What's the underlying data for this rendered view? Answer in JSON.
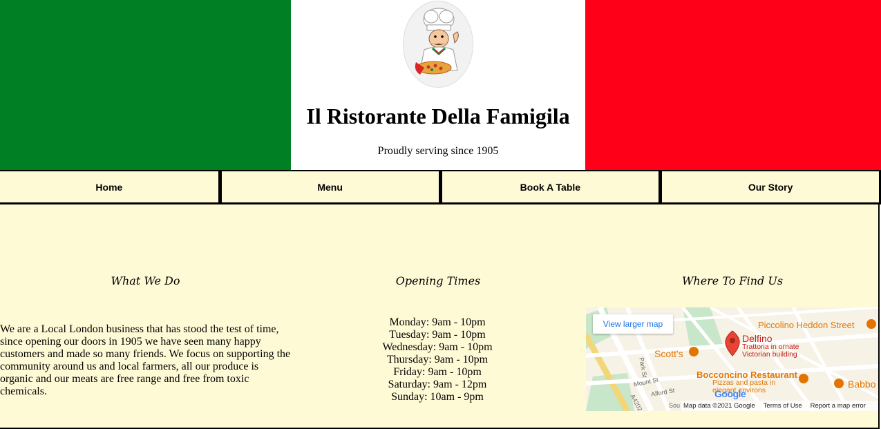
{
  "header": {
    "site_title": "Il Ristorante Della Famigila",
    "tagline": "Proudly serving since 1905",
    "colors": {
      "green": "#007f25",
      "white": "#ffffff",
      "red": "#ff0019"
    },
    "logo_icon": "chef-with-pizza-logo"
  },
  "nav": {
    "items": [
      {
        "label": "Home"
      },
      {
        "label": "Menu"
      },
      {
        "label": "Book A Table"
      },
      {
        "label": "Our Story"
      }
    ],
    "background": "#fffad6"
  },
  "what_we_do": {
    "heading": "What We Do",
    "body": "We are a Local London business that has stood the test of time, since opening our doors in 1905 we have seen many happy customers and made so many friends. We focus on supporting the community around us and local farmers, all our produce is organic and our meats are free range and free from toxic chemicals."
  },
  "opening_times": {
    "heading": "Opening Times",
    "rows": [
      "Monday: 9am - 10pm",
      "Tuesday: 9am - 10pm",
      "Wednesday: 9am - 10pm",
      "Thursday: 9am - 10pm",
      "Friday: 9am - 10pm",
      "Saturday: 9am - 12pm",
      "Sunday: 10am - 9pm"
    ]
  },
  "find_us": {
    "heading": "Where To Find Us",
    "map": {
      "view_larger": "View larger map",
      "places": {
        "piccolino": "Piccolino Heddon Street",
        "delfino": "Delfino",
        "delfino_desc_1": "Trattoria in ornate",
        "delfino_desc_2": "Victorian building",
        "scotts": "Scott's",
        "bocconcino": "Bocconcino Restaurant",
        "bocconcino_desc_1": "Pizzas and pasta in",
        "bocconcino_desc_2": "elegant environs",
        "babbo": "Babbo"
      },
      "streets": {
        "park_st": "Park St",
        "mount_st": "Mount St",
        "alford_st": "Alford St",
        "a4202": "A4202",
        "south": "Sou"
      },
      "google": "Google",
      "footer": {
        "data": "Map data ©2021 Google",
        "terms": "Terms of Use",
        "report": "Report a map error"
      }
    }
  }
}
